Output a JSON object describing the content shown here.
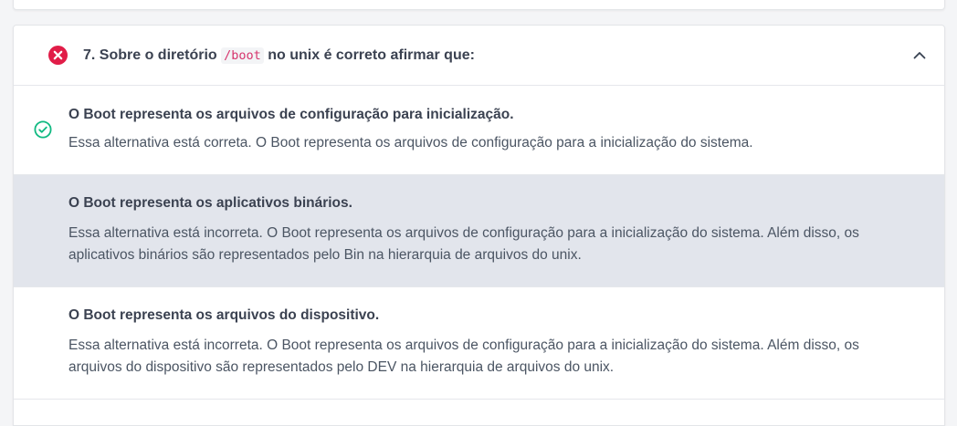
{
  "colors": {
    "wrong": "#e11d48",
    "correct": "#10b981",
    "code": "#d6336c",
    "selected_bg": "#e2e5ec"
  },
  "question": {
    "title_prefix": "7. Sobre o diretório",
    "code": "/boot",
    "title_suffix": "no unix é correto afirmar que:",
    "status_icon": "x-circle-icon",
    "toggle_icon": "chevron-up-icon"
  },
  "options": [
    {
      "title": "O Boot representa os arquivos de configuração para inicialização.",
      "text": "Essa alternativa está correta. O Boot representa os arquivos de configuração para a inicialização do sistema.",
      "status_icon": "check-circle-icon"
    },
    {
      "title": "O Boot representa os aplicativos binários.",
      "text": "Essa alternativa está incorreta. O Boot representa os arquivos de configuração para a inicialização do sistema. Além disso, os aplicativos binários são representados pelo Bin na hierarquia de arquivos do unix."
    },
    {
      "title": "O Boot representa os arquivos do dispositivo.",
      "text": "Essa alternativa está incorreta. O Boot representa os arquivos de configuração para a inicialização do sistema. Além disso, os arquivos do dispositivo são representados pelo DEV na hierarquia de arquivos do unix."
    }
  ]
}
